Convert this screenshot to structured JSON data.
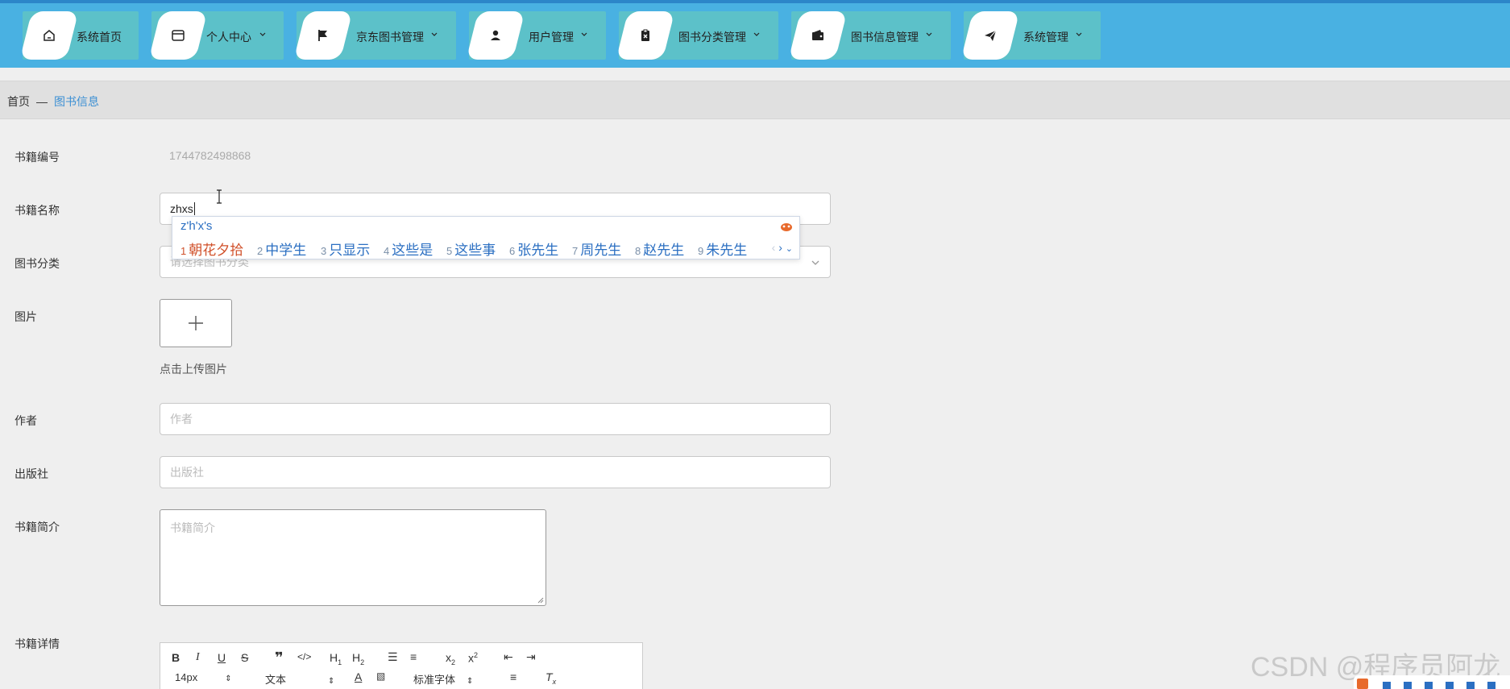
{
  "nav": {
    "items": [
      {
        "label": "系统首页",
        "icon": "home-icon",
        "dropdown": false
      },
      {
        "label": "个人中心",
        "icon": "card-icon",
        "dropdown": true
      },
      {
        "label": "京东图书管理",
        "icon": "flag-icon",
        "dropdown": true
      },
      {
        "label": "用户管理",
        "icon": "user-icon",
        "dropdown": true
      },
      {
        "label": "图书分类管理",
        "icon": "clipboard-icon",
        "dropdown": true
      },
      {
        "label": "图书信息管理",
        "icon": "wallet-icon",
        "dropdown": true
      },
      {
        "label": "系统管理",
        "icon": "send-icon",
        "dropdown": true
      }
    ]
  },
  "breadcrumb": {
    "home": "首页",
    "sep": "—",
    "current": "图书信息"
  },
  "form": {
    "book_id_label": "书籍编号",
    "book_id_value": "1744782498868",
    "book_name_label": "书籍名称",
    "book_name_value": "zhxs",
    "category_label": "图书分类",
    "category_placeholder": "请选择图书分类",
    "image_label": "图片",
    "upload_hint": "点击上传图片",
    "author_label": "作者",
    "author_placeholder": "作者",
    "publisher_label": "出版社",
    "publisher_placeholder": "出版社",
    "intro_label": "书籍简介",
    "intro_placeholder": "书籍简介",
    "detail_label": "书籍详情"
  },
  "editor": {
    "font_size": "14px",
    "paragraph": "文本",
    "font_family": "标准字体"
  },
  "ime": {
    "composition": "z'h'x's",
    "candidates": [
      {
        "n": "1",
        "text": "朝花夕拾"
      },
      {
        "n": "2",
        "text": "中学生"
      },
      {
        "n": "3",
        "text": "只显示"
      },
      {
        "n": "4",
        "text": "这些是"
      },
      {
        "n": "5",
        "text": "这些事"
      },
      {
        "n": "6",
        "text": "张先生"
      },
      {
        "n": "7",
        "text": "周先生"
      },
      {
        "n": "8",
        "text": "赵先生"
      },
      {
        "n": "9",
        "text": "朱先生"
      }
    ]
  },
  "watermark": "CSDN @程序员阿龙",
  "colors": {
    "topbar": "#49b1e2",
    "nav_item": "#5cc1c9",
    "link": "#3b8fd3",
    "ime_text": "#2b6fc2",
    "ime_first": "#d0502a"
  }
}
